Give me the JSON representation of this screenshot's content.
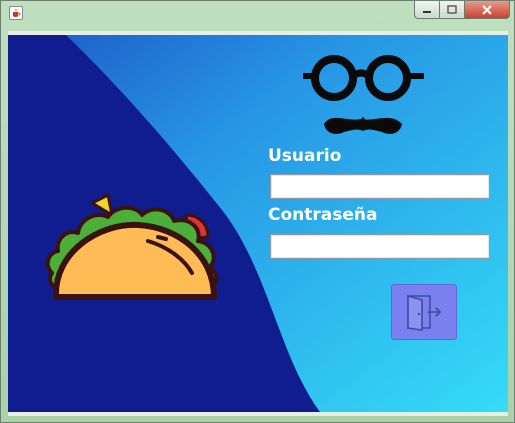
{
  "window": {
    "title": "",
    "controls": {
      "minimize": "minimize",
      "maximize": "maximize",
      "close": "close"
    }
  },
  "form": {
    "user_label": "Usuario",
    "user_value": "",
    "password_label": "Contraseña",
    "password_value": ""
  },
  "icons": {
    "app": "java-cup-icon",
    "logo": "glasses-mustache-icon",
    "illustration": "taco-icon",
    "login": "door-exit-icon"
  },
  "colors": {
    "panel_dark": "#0f1d8f",
    "gradient_light": "#35dcf7",
    "gradient_mid": "#2796e4",
    "button": "#7a80ee"
  }
}
